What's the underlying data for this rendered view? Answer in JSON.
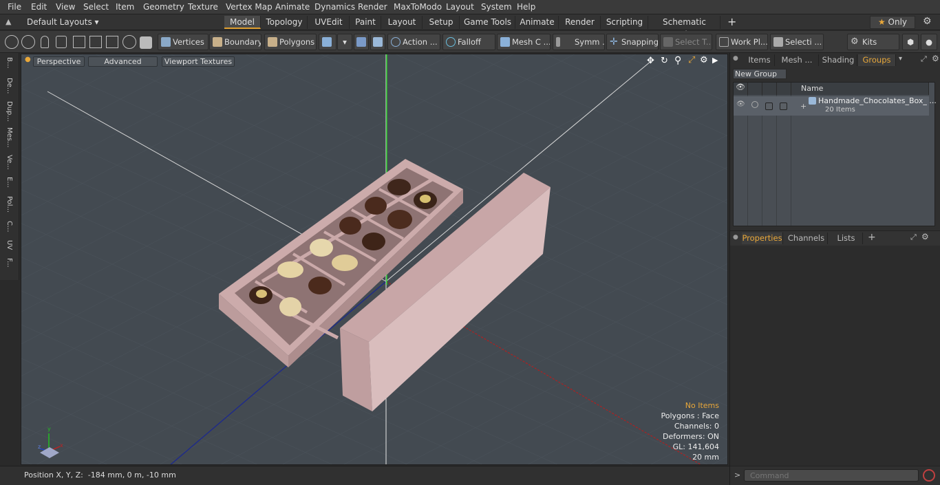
{
  "menu": [
    "File",
    "Edit",
    "View",
    "Select",
    "Item",
    "Geometry",
    "Texture",
    "Vertex Map",
    "Animate",
    "Dynamics",
    "Render",
    "MaxToModo",
    "Layout",
    "System",
    "Help"
  ],
  "layout_selector": "Default Layouts",
  "tabs": [
    "Model",
    "Topology",
    "UVEdit",
    "Paint",
    "Layout",
    "Setup",
    "Game Tools",
    "Animate",
    "Render",
    "Scripting",
    "Schematic Fusion"
  ],
  "active_tab": "Model",
  "only_label": "Only",
  "toolbar": {
    "vertices": "Vertices",
    "boundary": "Boundary",
    "polygons": "Polygons",
    "action": "Action",
    "falloff": "Falloff",
    "mesh": "Mesh C ...",
    "symm": "Symm ...",
    "snapping": "Snapping",
    "select_t": "Select T...",
    "workplane": "Work Pl...",
    "selection": "Selecti ...",
    "kits": "Kits",
    "action_more": "..."
  },
  "left_tabs": [
    "B...",
    "De...",
    "Dup...",
    "Mes...",
    "Ve...",
    "E...",
    "Pol...",
    "C...",
    "UV",
    "F..."
  ],
  "viewport": {
    "perspective": "Perspective",
    "advanced": "Advanced",
    "textures": "Viewport Textures",
    "hud": {
      "no_items": "No Items",
      "polygons": "Polygons : Face",
      "channels": "Channels: 0",
      "deformers": "Deformers: ON",
      "gl": "GL: 141,604",
      "scale": "20 mm"
    },
    "axis": {
      "x": "x",
      "y": "y",
      "z": "z"
    }
  },
  "status": {
    "position": "Position X, Y, Z:  -184 mm, 0 m, -10 mm"
  },
  "right_tabs": [
    "Items",
    "Mesh ...",
    "Shading",
    "Groups"
  ],
  "active_right_tab": "Groups",
  "groups": {
    "new_group": "New Group",
    "column_name": "Name",
    "item_name": "Handmade_Chocolates_Box_ ...",
    "item_count": "20 Items"
  },
  "properties_tabs": [
    "Properties",
    "Channels",
    "Lists"
  ],
  "command_placeholder": "Command",
  "colors": {
    "accent": "#e9a83a",
    "viewport": "#434a51",
    "box": "#dcc0bf"
  }
}
